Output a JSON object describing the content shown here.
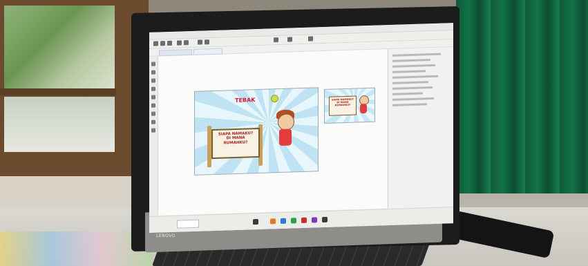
{
  "scene": {
    "description_tags": [
      "monitor",
      "design-software",
      "window",
      "curtain",
      "keyboard",
      "phone"
    ]
  },
  "monitor": {
    "brand": "LENOVO"
  },
  "slide": {
    "title": "TEBAK",
    "board_lines": [
      "SIAPA NAMAKU?",
      "DI MANA",
      "RUMAHKU?"
    ]
  },
  "slide_small": {
    "board_lines": [
      "SIAPA NAMAKU?",
      "DI MANA",
      "RUMAHKU?"
    ]
  },
  "colors": {
    "curtain": "#137247",
    "wall": "#a6a094",
    "bezel": "#1c1c1c",
    "slide_sky": "#bfe3f2",
    "title_red": "#d41f2b"
  }
}
